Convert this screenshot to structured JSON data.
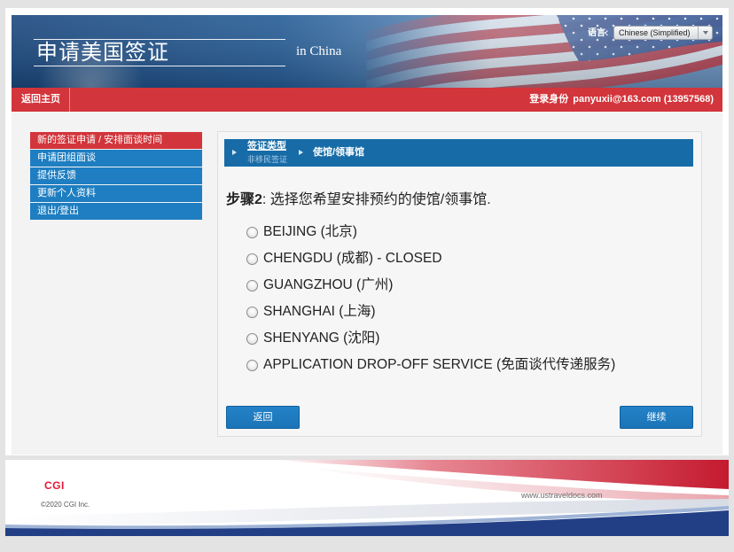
{
  "header": {
    "title": "申请美国签证",
    "subtitle": "in China",
    "language_label": "语言:",
    "language_value": "Chinese (Simplified)"
  },
  "navbar": {
    "home_link": "返回主页",
    "login_label": "登录身份",
    "login_user": "panyuxii@163.com (13957568)"
  },
  "sidebar": {
    "items": [
      {
        "label": "新的签证申请 / 安排面谈时间",
        "active": true
      },
      {
        "label": "申请团组面谈",
        "active": false
      },
      {
        "label": "提供反馈",
        "active": false
      },
      {
        "label": "更新个人资料",
        "active": false
      },
      {
        "label": "退出/登出",
        "active": false
      }
    ]
  },
  "breadcrumb": {
    "steps": [
      {
        "label": "签证类型",
        "sublabel": "非移民签证"
      },
      {
        "label": "使馆/领事馆"
      }
    ]
  },
  "step": {
    "label": "步骤2",
    "instruction": ": 选择您希望安排预约的使馆/领事馆."
  },
  "posts": {
    "options": [
      {
        "label": "BEIJING (北京)",
        "selected": false
      },
      {
        "label": "CHENGDU (成都) - CLOSED",
        "selected": false
      },
      {
        "label": "GUANGZHOU (广州)",
        "selected": false
      },
      {
        "label": "SHANGHAI (上海)",
        "selected": false
      },
      {
        "label": "SHENYANG (沈阳)",
        "selected": false
      },
      {
        "label": "APPLICATION DROP-OFF SERVICE (免面谈代传递服务)",
        "selected": false
      }
    ]
  },
  "buttons": {
    "back": "返回",
    "continue": "继续"
  },
  "footer": {
    "logo": "CGI",
    "copyright": "©2020 CGI Inc.",
    "url": "www.ustraveldocs.com"
  },
  "colors": {
    "nav-red": "#d2353b",
    "side-blue": "#1e7ec1",
    "crumb-blue": "#176ca7",
    "btn-blue": "#1b74b7",
    "cgi-red": "#e11937"
  },
  "icons": {
    "breadcrumb_arrow": "arrow-right-icon",
    "language_dropdown": "chevron-down-icon",
    "option_radio": "radio-button-icon"
  }
}
